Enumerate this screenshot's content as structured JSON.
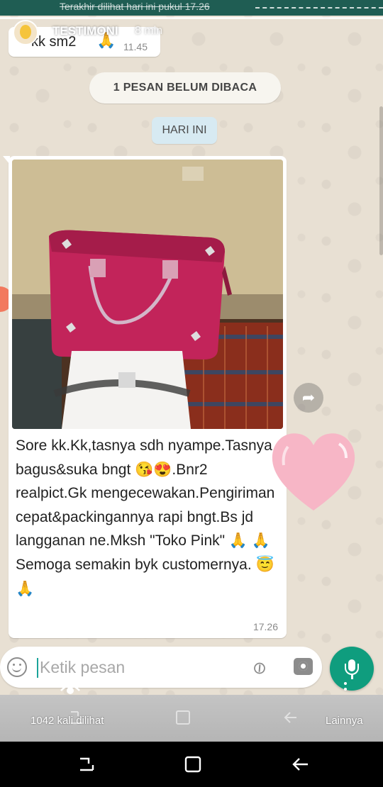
{
  "header": {
    "last_seen": "Terakhir dilihat hari ini pukul 17.26"
  },
  "story": {
    "author": "TESTIMONI",
    "time_ago": "8 min",
    "views": "1042 kali dilihat",
    "more_label": "Lainnya"
  },
  "previous_message": {
    "text": "kk sm2",
    "emoji": "🙏",
    "time": "11.45"
  },
  "unread_banner": "1 PESAN BELUM DIBACA",
  "date_divider": "HARI INI",
  "message": {
    "text": "Sore kk.Kk,tasnya sdh nyampe.Tasnya bagus&suka bngt 😘😍.Bnr2 realpict.Gk mengecewakan.Pengiriman cepat&packingannya rapi bngt.Bs jd langganan ne.Mksh \"Toko Pink\" 🙏 🙏\nSemoga semakin byk customernya. 😇🙏",
    "time": "17.26"
  },
  "composer": {
    "placeholder": "Ketik pesan"
  },
  "colors": {
    "accent": "#0f9d7e",
    "chat_background": "#e8e0d3",
    "bubble": "#ffffff",
    "unread_pill": "#f7f5ef",
    "date_pill": "#d7eaf2",
    "heart": "#f7b6c6"
  },
  "icons": {
    "emoji": "smiley-icon",
    "attach": "paperclip-icon",
    "camera": "camera-icon",
    "mic": "microphone-icon",
    "forward": "forward-icon",
    "eye": "eye-icon",
    "heart": "heart-icon"
  }
}
